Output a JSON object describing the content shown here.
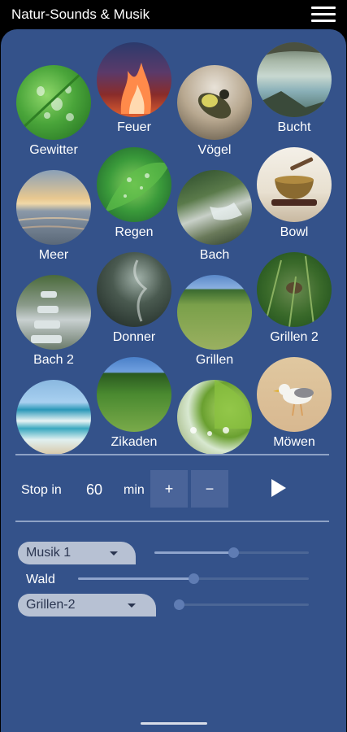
{
  "app": {
    "title": "Natur-Sounds & Musik",
    "menu_icon": "hamburger-menu-icon"
  },
  "sounds": [
    {
      "name": "gewitter",
      "label": "Gewitter"
    },
    {
      "name": "feuer",
      "label": "Feuer"
    },
    {
      "name": "voegel",
      "label": "Vögel"
    },
    {
      "name": "bucht",
      "label": "Bucht"
    },
    {
      "name": "meer",
      "label": "Meer"
    },
    {
      "name": "regen",
      "label": "Regen"
    },
    {
      "name": "bach",
      "label": "Bach"
    },
    {
      "name": "bowl",
      "label": "Bowl"
    },
    {
      "name": "bach-2",
      "label": "Bach 2"
    },
    {
      "name": "donner",
      "label": "Donner"
    },
    {
      "name": "grillen",
      "label": "Grillen"
    },
    {
      "name": "grillen-2",
      "label": "Grillen 2"
    },
    {
      "name": "brandung",
      "label": ""
    },
    {
      "name": "zikaden",
      "label": "Zikaden"
    },
    {
      "name": "tropfen",
      "label": ""
    },
    {
      "name": "moewen",
      "label": "Möwen"
    }
  ],
  "timer": {
    "stop_label": "Stop in",
    "minutes": "60",
    "unit": "min",
    "plus_label": "+",
    "minus_label": "−",
    "play_icon": "play-icon"
  },
  "mixer": {
    "track1": {
      "selected": "Musik 1",
      "volume": 0.51
    },
    "track2": {
      "label": "Wald",
      "volume": 0.5
    },
    "track3": {
      "selected": "Grillen-2",
      "volume": 0.0
    }
  },
  "colors": {
    "panel": "#34528a",
    "topbar": "#000000",
    "accent": "#8fa4cc"
  }
}
